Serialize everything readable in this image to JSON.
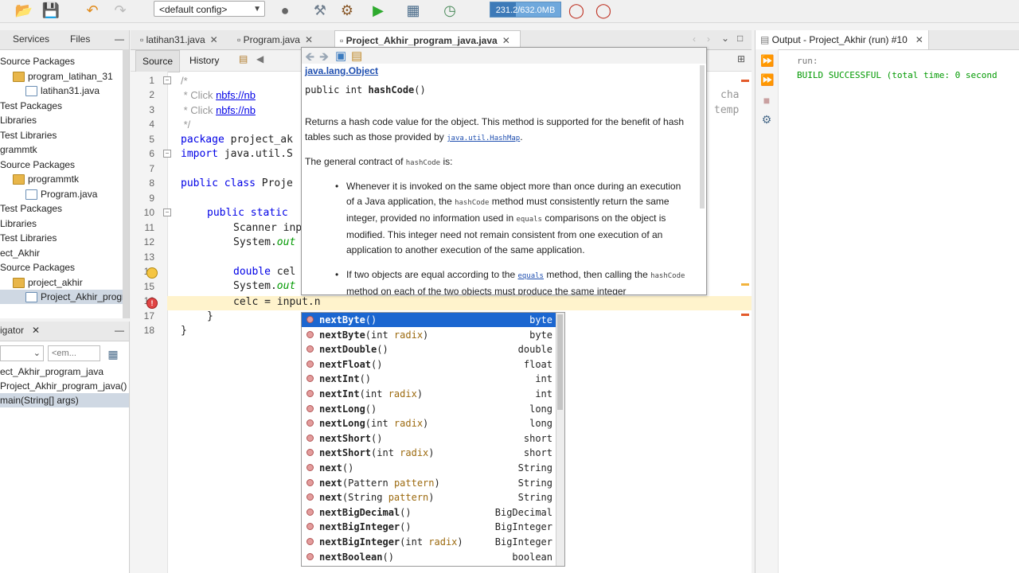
{
  "toolbar": {
    "config": "<default config>",
    "memory": "231.2/632.0MB",
    "memory_fraction": 0.366
  },
  "projects_panel": {
    "tabs": [
      "Services",
      "Files"
    ],
    "tree": [
      {
        "label": "Source Packages",
        "icon": "none"
      },
      {
        "label": "program_latihan_31",
        "icon": "package"
      },
      {
        "label": "latihan31.java",
        "icon": "java-file"
      },
      {
        "label": "Test Packages",
        "icon": "none"
      },
      {
        "label": "Libraries",
        "icon": "none"
      },
      {
        "label": "Test Libraries",
        "icon": "none"
      },
      {
        "label": "grammtk",
        "icon": "none"
      },
      {
        "label": "Source Packages",
        "icon": "none"
      },
      {
        "label": "programmtk",
        "icon": "package"
      },
      {
        "label": "Program.java",
        "icon": "java-file"
      },
      {
        "label": "Test Packages",
        "icon": "none"
      },
      {
        "label": "Libraries",
        "icon": "none"
      },
      {
        "label": "Test Libraries",
        "icon": "none"
      },
      {
        "label": "ect_Akhir",
        "icon": "none"
      },
      {
        "label": "Source Packages",
        "icon": "none"
      },
      {
        "label": "project_akhir",
        "icon": "package"
      },
      {
        "label": "Project_Akhir_program",
        "icon": "java-file",
        "selected": true
      }
    ]
  },
  "navigator": {
    "title": "igator",
    "filter_placeholder": "<em...",
    "items": [
      "ect_Akhir_program_java",
      "Project_Akhir_program_java()",
      "main(String[] args)"
    ]
  },
  "editor": {
    "tabs": [
      "latihan31.java",
      "Program.java",
      "Project_Akhir_program_java.java"
    ],
    "source_tab": "Source",
    "history_tab": "History",
    "line_numbers": [
      "1",
      "2",
      "3",
      "4",
      "5",
      "6",
      "7",
      "8",
      "9",
      "10",
      "11",
      "12",
      "13",
      "14",
      "15",
      "16",
      "17",
      "18"
    ],
    "lines": {
      "l1": "/*",
      "l2_prefix": " * Click ",
      "l2_link": "nbfs://nb",
      "l3_prefix": " * Click ",
      "l3_link": "nbfs://nb",
      "l4": " */",
      "l5_kw": "package",
      "l5_rest": " project_ak",
      "l6_kw": "import",
      "l6_rest": " java.util.S",
      "l8_kw": "public class",
      "l8_rest": " Proje",
      "l10_kw": "public static",
      "l11": "Scanner inp",
      "l12_a": "System.",
      "l12_b": "out",
      "l14_kw": "double",
      "l14_rest": " cel",
      "l15_a": "System.",
      "l15_b": "out",
      "l16": "celc = input.n",
      "l17": "}",
      "l18": "}",
      "right_a": "cha",
      "right_b": "temp"
    }
  },
  "javadoc": {
    "class": "java.lang.Object",
    "sig_prefix": "public int ",
    "sig_method": "hashCode",
    "sig_suffix": "()",
    "desc_1": "Returns a hash code value for the object. This method is supported for the benefit of hash tables such as those provided by ",
    "desc_link": "java.util.HashMap",
    "desc_2": ".",
    "contract_1": "The general contract of ",
    "contract_code": "hashCode",
    "contract_2": " is:",
    "b1_1": "Whenever it is invoked on the same object more than once during an execution of a Java application, the ",
    "b1_code1": "hashCode",
    "b1_2": " method must consistently return the same integer, provided no information used in ",
    "b1_code2": "equals",
    "b1_3": " comparisons on the object is modified. This integer need not remain consistent from one execution of an application to another execution of the same application.",
    "b2_1": "If two objects are equal according to the ",
    "b2_link": "equals",
    "b2_2": " method, then calling the ",
    "b2_code": "hashCode",
    "b2_3": " method on each of the two objects must produce the same integer"
  },
  "completion": [
    {
      "name": "nextByte",
      "params": "()",
      "ret": "byte",
      "selected": true
    },
    {
      "name": "nextByte",
      "params_open": "(int ",
      "pname": "radix",
      "params_close": ")",
      "ret": "byte"
    },
    {
      "name": "nextDouble",
      "params": "()",
      "ret": "double"
    },
    {
      "name": "nextFloat",
      "params": "()",
      "ret": "float"
    },
    {
      "name": "nextInt",
      "params": "()",
      "ret": "int"
    },
    {
      "name": "nextInt",
      "params_open": "(int ",
      "pname": "radix",
      "params_close": ")",
      "ret": "int"
    },
    {
      "name": "nextLong",
      "params": "()",
      "ret": "long"
    },
    {
      "name": "nextLong",
      "params_open": "(int ",
      "pname": "radix",
      "params_close": ")",
      "ret": "long"
    },
    {
      "name": "nextShort",
      "params": "()",
      "ret": "short"
    },
    {
      "name": "nextShort",
      "params_open": "(int ",
      "pname": "radix",
      "params_close": ")",
      "ret": "short"
    },
    {
      "name": "next",
      "params": "()",
      "ret": "String"
    },
    {
      "name": "next",
      "params_open": "(Pattern ",
      "pname": "pattern",
      "params_close": ")",
      "ret": "String"
    },
    {
      "name": "next",
      "params_open": "(String ",
      "pname": "pattern",
      "params_close": ")",
      "ret": "String"
    },
    {
      "name": "nextBigDecimal",
      "params": "()",
      "ret": "BigDecimal"
    },
    {
      "name": "nextBigInteger",
      "params": "()",
      "ret": "BigInteger"
    },
    {
      "name": "nextBigInteger",
      "params_open": "(int ",
      "pname": "radix",
      "params_close": ")",
      "ret": "BigInteger"
    },
    {
      "name": "nextBoolean",
      "params": "()",
      "ret": "boolean"
    }
  ],
  "output": {
    "tab": "Output - Project_Akhir (run) #10",
    "line1": "run:",
    "line2": "BUILD SUCCESSFUL (total time: 0 second"
  },
  "colors": {
    "keyword": "#0000e6",
    "comment": "#969696",
    "selection": "#1b66d0",
    "output_text": "#009900"
  }
}
